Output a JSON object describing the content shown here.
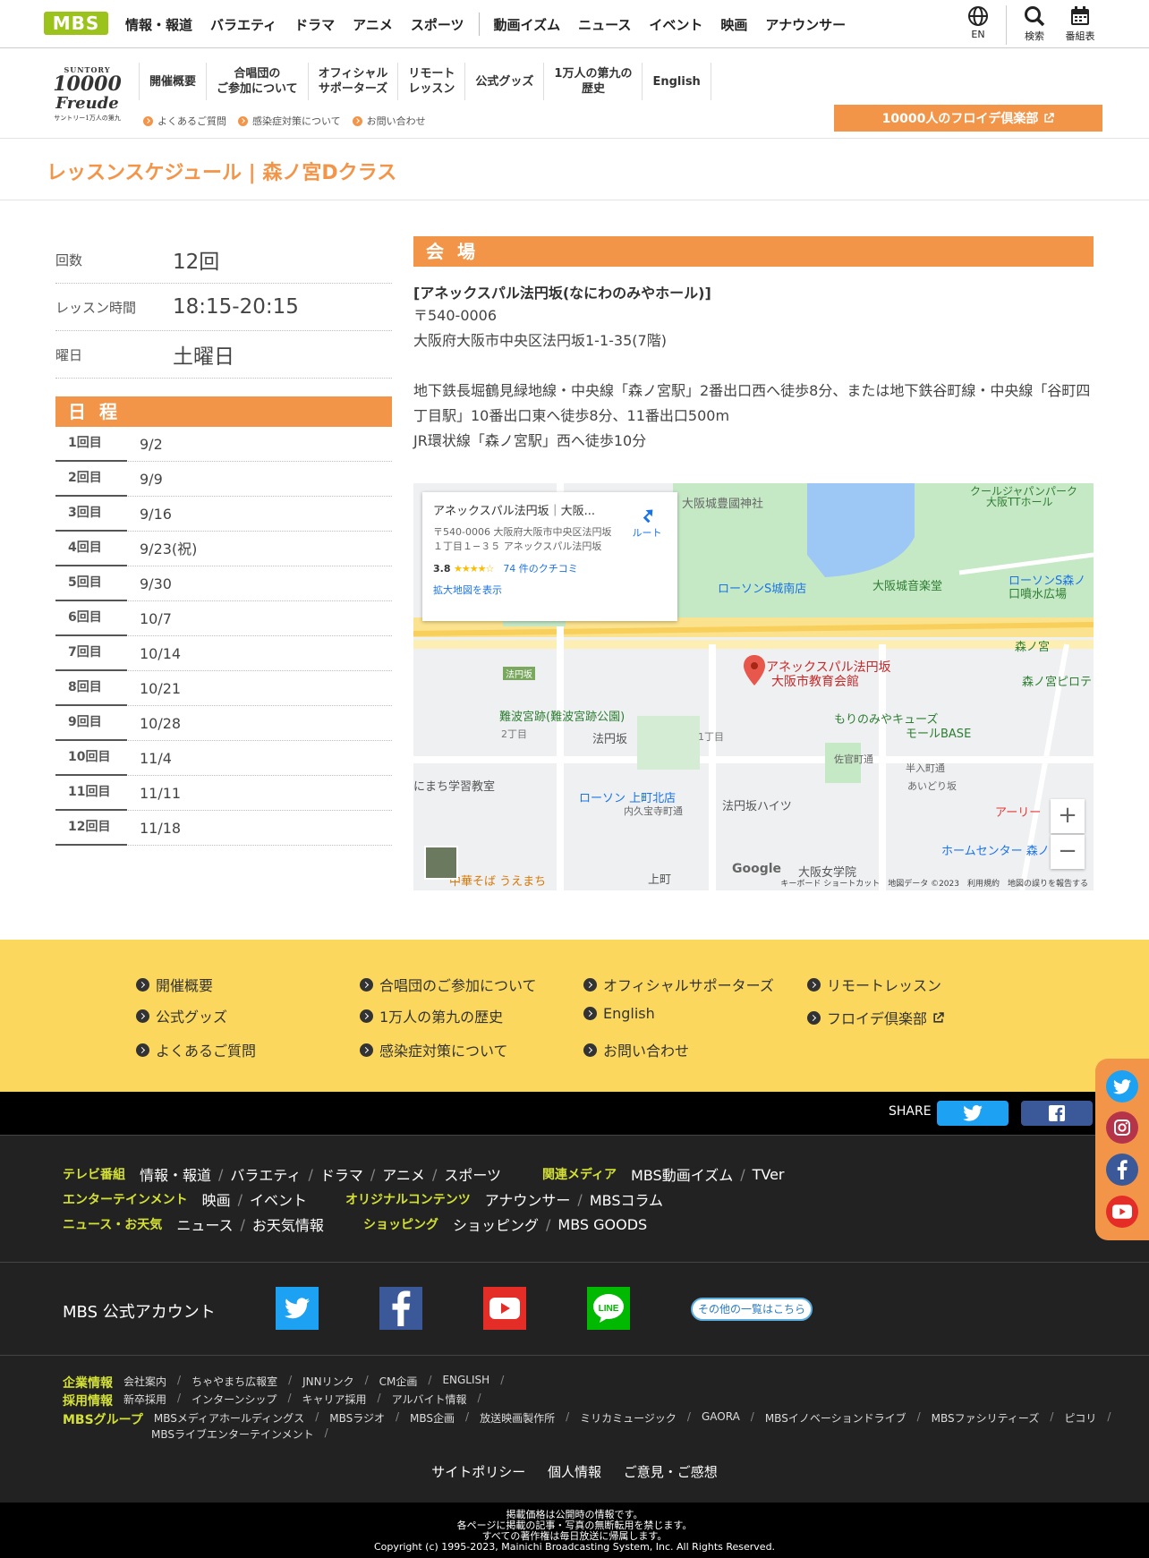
{
  "header": {
    "logo": "MBS",
    "nav": [
      "情報・報道",
      "バラエティ",
      "ドラマ",
      "アニメ",
      "スポーツ"
    ],
    "nav2": [
      "動画イズム",
      "ニュース",
      "イベント",
      "映画",
      "アナウンサー"
    ],
    "tools": {
      "lang": "EN",
      "search": "検索",
      "schedule": "番組表"
    }
  },
  "subheader": {
    "logo": {
      "brand": "SUNTORY",
      "num": "10000",
      "word": "Freude",
      "sub": "サントリー1万人の第九"
    },
    "nav": [
      "開催概要",
      "合唱団の\nご参加について",
      "オフィシャル\nサポーターズ",
      "リモート\nレッスン",
      "公式グッズ",
      "1万人の第九の\n歴史",
      "English"
    ],
    "links": [
      "よくあるご質問",
      "感染症対策について",
      "お問い合わせ"
    ],
    "club_button": "10000人のフロイデ倶楽部"
  },
  "page_title": "レッスンスケジュール | 森ノ宮Dクラス",
  "info": [
    {
      "label": "回数",
      "value": "12回"
    },
    {
      "label": "レッスン時間",
      "value": "18:15-20:15"
    },
    {
      "label": "曜日",
      "value": "土曜日"
    }
  ],
  "schedule": {
    "heading": "日 程",
    "rows": [
      {
        "n": "1回目",
        "d": "9/2"
      },
      {
        "n": "2回目",
        "d": "9/9"
      },
      {
        "n": "3回目",
        "d": "9/16"
      },
      {
        "n": "4回目",
        "d": "9/23(祝)"
      },
      {
        "n": "5回目",
        "d": "9/30"
      },
      {
        "n": "6回目",
        "d": "10/7"
      },
      {
        "n": "7回目",
        "d": "10/14"
      },
      {
        "n": "8回目",
        "d": "10/21"
      },
      {
        "n": "9回目",
        "d": "10/28"
      },
      {
        "n": "10回目",
        "d": "11/4"
      },
      {
        "n": "11回目",
        "d": "11/11"
      },
      {
        "n": "12回目",
        "d": "11/18"
      }
    ]
  },
  "venue": {
    "heading": "会 場",
    "name": "[アネックスパル法円坂(なにわのみやホール)]",
    "zip": "〒540-0006",
    "address": "大阪府大阪市中央区法円坂1-1-35(7階)",
    "access1": "地下鉄長堀鶴見緑地線・中央線「森ノ宮駅」2番出口西へ徒歩8分、または地下鉄谷町線・中央線「谷町四丁目駅」10番出口東へ徒歩8分、11番出口500m",
    "access2": "JR環状線「森ノ宮駅」西へ徒歩10分"
  },
  "map": {
    "card_title": "アネックスパル法円坂｜大阪...",
    "card_address": "〒540-0006 大阪府大阪市中央区法円坂１丁目１−３５ アネックスパル法円坂",
    "rating": "3.8",
    "stars": "★★★★☆",
    "reviews": "74 件のクチコミ",
    "enlarge": "拡大地図を表示",
    "route": "ルート",
    "pin_label1": "アネックスパル法円坂",
    "pin_label2": "大阪市教育会館",
    "labels": [
      "大阪城豊國神社",
      "ローソンS城南店",
      "大阪城音楽堂",
      "ローソンS森ノ",
      "口噴水広場",
      "森ノ宮",
      "森ノ宮ピロテ",
      "もりのみやキューズ",
      "モールBASE",
      "難波宮跡(難波宮跡公園)",
      "法円坂",
      "2丁目",
      "1丁目",
      "にまち学習教室",
      "ローソン 上町北店",
      "法円坂ハイツ",
      "内久宝寺町通",
      "大阪女学院",
      "ホームセンター 森ノ",
      "中華そば うえまち",
      "上町",
      "佐官町通",
      "半入町通",
      "あいどり坂",
      "アーリー",
      "クールジャパンパーク",
      "大阪TTホール",
      "法円坂"
    ],
    "google": "Google",
    "footer": "キーボード ショートカット　地図データ ©2023　利用規約　地図の誤りを報告する"
  },
  "footer_links": [
    [
      "開催概要",
      "合唱団のご参加について",
      "オフィシャルサポーターズ",
      "リモートレッスン"
    ],
    [
      "公式グッズ",
      "1万人の第九の歴史",
      "English",
      "フロイデ倶楽部"
    ],
    [
      "よくあるご質問",
      "感染症対策について",
      "お問い合わせ"
    ]
  ],
  "share_label": "SHARE",
  "mbs_footer": {
    "rows": [
      [
        {
          "cat": "テレビ番組",
          "items": [
            "情報・報道",
            "バラエティ",
            "ドラマ",
            "アニメ",
            "スポーツ"
          ]
        },
        {
          "cat": "関連メディア",
          "items": [
            "MBS動画イズム",
            "TVer"
          ]
        }
      ],
      [
        {
          "cat": "エンターテインメント",
          "items": [
            "映画",
            "イベント"
          ]
        },
        {
          "cat": "オリジナルコンテンツ",
          "items": [
            "アナウンサー",
            "MBSコラム"
          ]
        }
      ],
      [
        {
          "cat": "ニュース・お天気",
          "items": [
            "ニュース",
            "お天気情報"
          ]
        },
        {
          "cat": "ショッピング",
          "items": [
            "ショッピング",
            "MBS GOODS"
          ]
        }
      ]
    ],
    "account_label": "MBS 公式アカウント",
    "more_button": "その他の一覧はこちら",
    "corp": [
      {
        "cat": "企業情報",
        "items": [
          "会社案内",
          "ちゃやまち広報室",
          "JNNリンク",
          "CM企画",
          "ENGLISH"
        ]
      },
      {
        "cat": "採用情報",
        "items": [
          "新卒採用",
          "インターンシップ",
          "キャリア採用",
          "アルバイト情報"
        ]
      },
      {
        "cat": "MBSグループ",
        "items": [
          "MBSメディアホールディングス",
          "MBSラジオ",
          "MBS企画",
          "放送映画製作所",
          "ミリカミュージック",
          "GAORA",
          "MBSイノベーションドライブ",
          "MBSファシリティーズ",
          "ピコリ"
        ]
      },
      {
        "cat": "",
        "items": [
          "MBSライブエンターテインメント"
        ]
      }
    ],
    "policy": [
      "サイトポリシー",
      "個人情報",
      "ご意見・ご感想"
    ],
    "copyright": [
      "掲載価格は公開時の情報です。",
      "各ページに掲載の記事・写真の無断転用を禁じます。",
      "すべての著作権は毎日放送に帰属します。",
      "Copyright (c) 1995-2023, Mainichi Broadcasting System, Inc. All Rights Reserved."
    ]
  },
  "colors": {
    "accent": "#f39549",
    "logo": "#9bc31c",
    "yellow": "#fbd85d",
    "twitter": "#1da1f2",
    "facebook": "#3b5998",
    "youtube": "#e52d27",
    "line": "#00b900"
  }
}
